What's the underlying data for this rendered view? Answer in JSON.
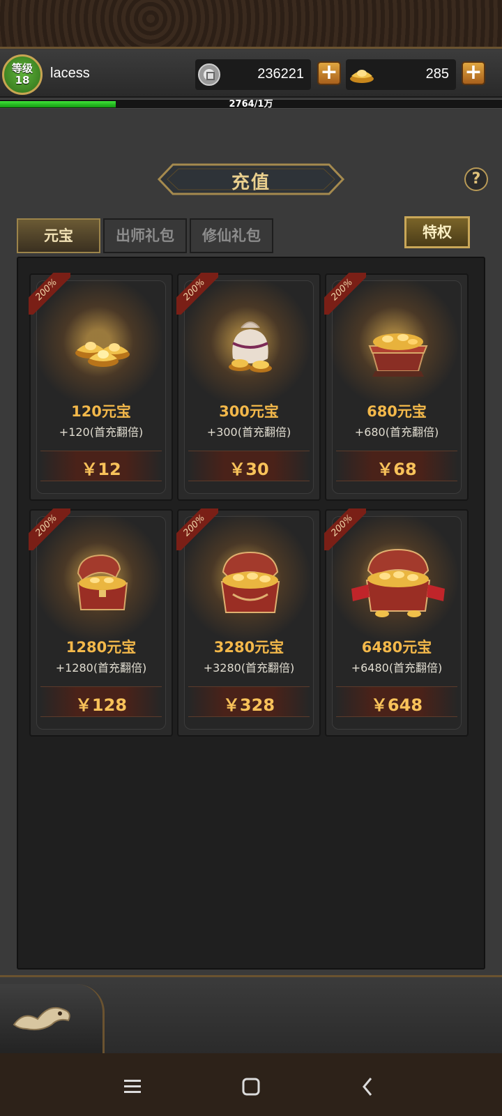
{
  "header": {
    "level_label": "等级",
    "level_value": "18",
    "username": "lacess",
    "coins": "236221",
    "ingots": "285",
    "exp_text": "2764/1万",
    "exp_fraction": 0.2764
  },
  "title": "充值",
  "help_label": "?",
  "tabs": [
    {
      "label": "元宝",
      "active": true
    },
    {
      "label": "出师礼包",
      "active": false
    },
    {
      "label": "修仙礼包",
      "active": false
    }
  ],
  "privilege_label": "特权",
  "cards": [
    {
      "badge": "200%",
      "name": "120元宝",
      "bonus": "+120(首充翻倍)",
      "price": "￥12",
      "icon": "gold-ingots-icon"
    },
    {
      "badge": "200%",
      "name": "300元宝",
      "bonus": "+300(首充翻倍)",
      "price": "￥30",
      "icon": "ingot-bag-icon"
    },
    {
      "badge": "200%",
      "name": "680元宝",
      "bonus": "+680(首充翻倍)",
      "price": "￥68",
      "icon": "ingot-box-icon"
    },
    {
      "badge": "200%",
      "name": "1280元宝",
      "bonus": "+1280(首充翻倍)",
      "price": "￥128",
      "icon": "treasure-chest-icon"
    },
    {
      "badge": "200%",
      "name": "3280元宝",
      "bonus": "+3280(首充翻倍)",
      "price": "￥328",
      "icon": "large-treasure-chest-icon"
    },
    {
      "badge": "200%",
      "name": "6480元宝",
      "bonus": "+6480(首充翻倍)",
      "price": "￥648",
      "icon": "grand-treasure-chest-icon"
    }
  ],
  "colors": {
    "accent_gold": "#f3b84a",
    "exp_green": "#3fe33a",
    "badge_red": "#7a1f16",
    "price_gold": "#f8c25a"
  }
}
